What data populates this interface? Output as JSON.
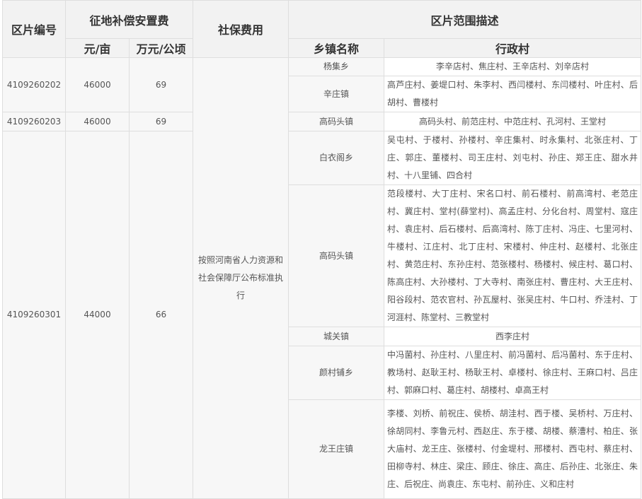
{
  "header": {
    "zone_id": "区片编号",
    "compensation": "征地补偿安置费",
    "social_security": "社保费用",
    "zone_scope": "区片范围描述",
    "yuan_per_mu": "元/亩",
    "wan_per_hectare": "万元/公顷",
    "township": "乡镇名称",
    "villages": "行政村"
  },
  "zones": [
    {
      "id": "4109260202",
      "yuan_per_mu": "46000",
      "wan_per_hectare": "69"
    },
    {
      "id": "4109260203",
      "yuan_per_mu": "46000",
      "wan_per_hectare": "69"
    },
    {
      "id": "4109260301",
      "yuan_per_mu": "44000",
      "wan_per_hectare": "66"
    }
  ],
  "social_security_note": "按照河南省人力资源和社会保障厅公布标准执行",
  "rows": [
    {
      "township": "杨集乡",
      "villages": "李辛店村、焦庄村、王辛店村、刘辛店村"
    },
    {
      "township": "辛庄镇",
      "villages": "高芦庄村、姜堤口村、朱李村、西闫楼村、东闫楼村、叶庄村、后胡村、曹楼村"
    },
    {
      "township": "高码头镇",
      "villages": "高码头村、前范庄村、中范庄村、孔河村、王堂村"
    },
    {
      "township": "白衣阁乡",
      "villages": "吴屯村、于楼村、孙楼村、辛庄集村、时永集村、北张庄村、丁庄、郭庄、董楼村、司王庄村、刘屯村、孙庄、郑王庄、甜水井村、十八里铺、四合村"
    },
    {
      "township": "高码头镇",
      "villages": "范段楼村、大丁庄村、宋名口村、前石楼村、前高湾村、老范庄村、冀庄村、堂村(薛堂村)、高孟庄村、分化台村、周堂村、寇庄村、袁庄村、后石楼村、后高湾村、陈丁庄村、冯庄、七里河村、牛楼村、江庄村、北丁庄村、宋楼村、仲庄村、赵楼村、北张庄村、黄范庄村、东孙庄村、范张楼村、杨楼村、候庄村、葛口村、陈高庄村、大孙楼村、丁大寺村、南张庄村、曹庄村、大王庄村、阳谷段村、范农官村、孙瓦屋村、张吴庄村、牛口村、乔洼村、丁河涯村、陈堂村、三教堂村"
    },
    {
      "township": "城关镇",
      "villages": "西李庄村"
    },
    {
      "township": "颜村铺乡",
      "villages": "中冯菌村、孙庄村、八里庄村、前冯菌村、后冯菌村、东于庄村、教场村、赵耿王村、杨耿王村、卓楼村、徐庄村、王麻口村、吕庄村、郭麻口村、葛庄村、胡楼村、卓高王村"
    },
    {
      "township": "龙王庄镇",
      "villages": "李楼、刘桥、前祝庄、侯桥、胡洼村、西于楼、吴桥村、万庄村、徐胡同村、李鲁元村、西赵庄、东于楼、胡楼、蔡漕村、柏庄、张大庙村、龙王庄、张楼村、付金堤村、邢楼村、西屯村、蔡庄村、田柳寺村、林庄、梁庄、顾庄、徐庄、高庄、后孙庄、北张庄、朱庄、后祝庄、尚袁庄、东屯村、前孙庄、义和庄村"
    }
  ]
}
